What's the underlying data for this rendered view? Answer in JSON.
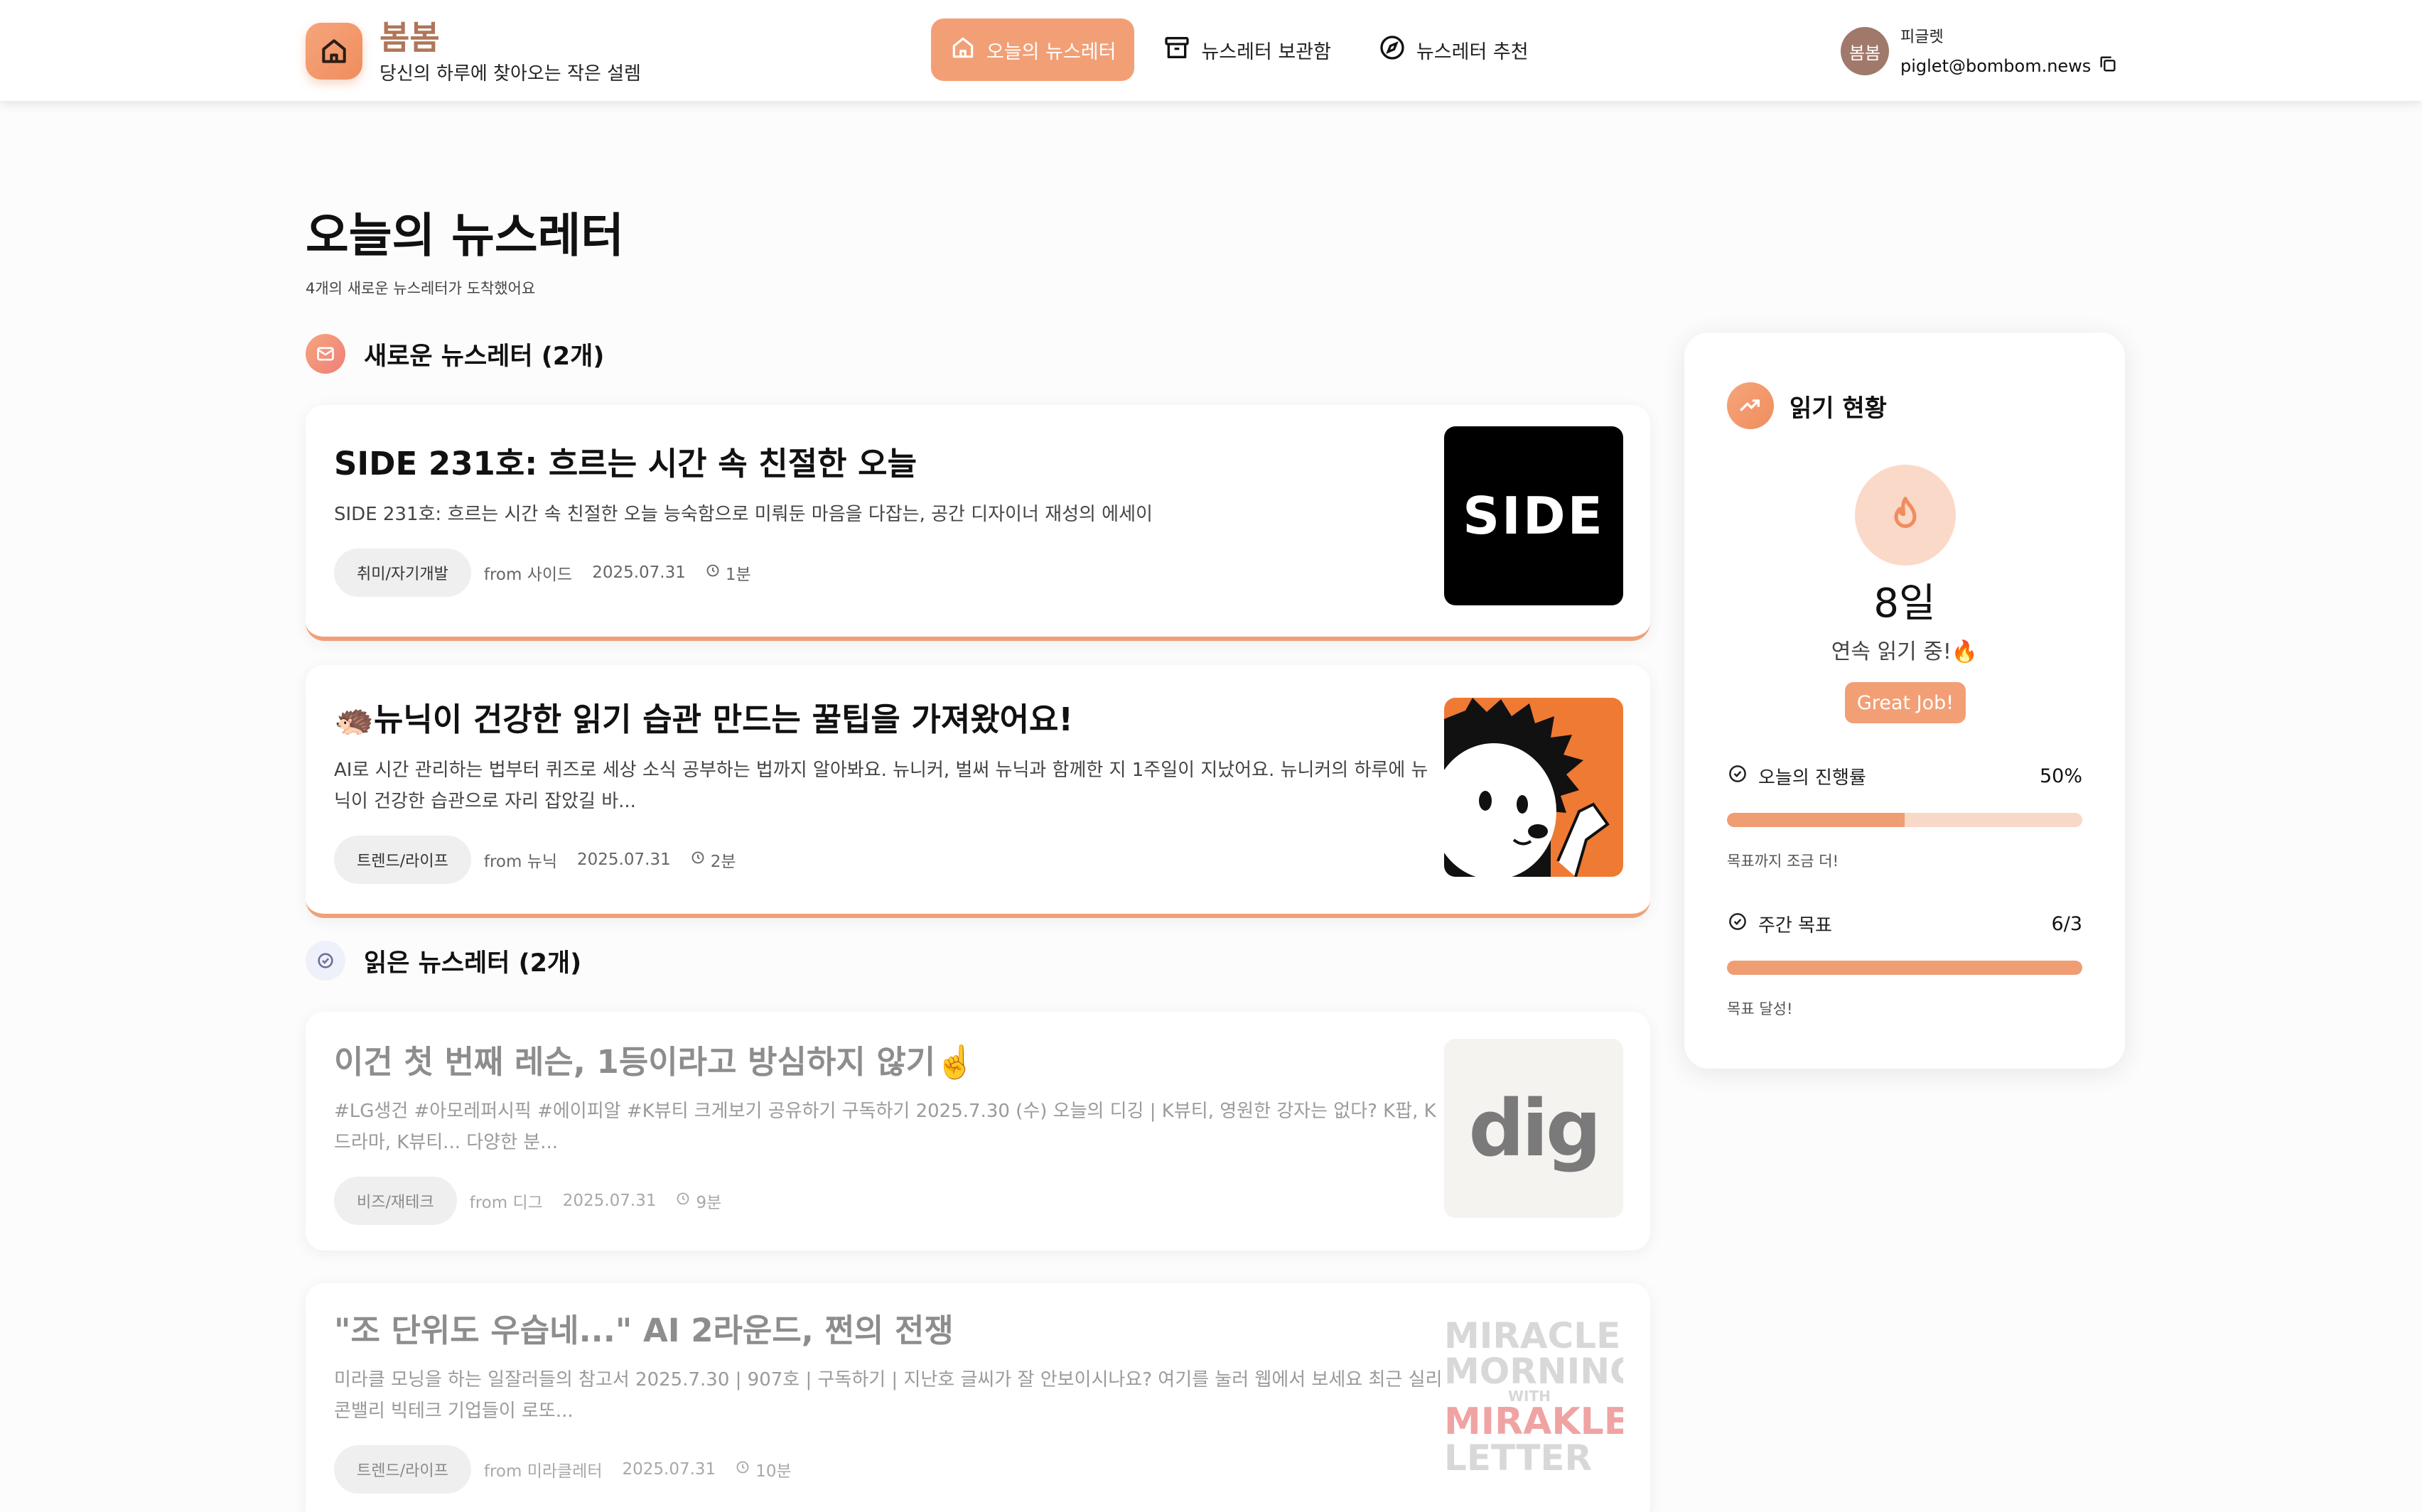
{
  "header": {
    "brand_name": "봄봄",
    "tagline": "당신의 하루에 찾아오는 작은 설렘",
    "nav": [
      {
        "label": "오늘의 뉴스레터",
        "icon": "home-icon",
        "active": true
      },
      {
        "label": "뉴스레터 보관함",
        "icon": "archive-icon",
        "active": false
      },
      {
        "label": "뉴스레터 추천",
        "icon": "compass-icon",
        "active": false
      }
    ],
    "user": {
      "avatar_text": "봄봄",
      "name": "피글렛",
      "email": "piglet@bombom.news"
    }
  },
  "main": {
    "title": "오늘의 뉴스레터",
    "subtitle": "4개의 새로운 뉴스레터가 도착했어요",
    "unread_section": "새로운 뉴스레터 (2개)",
    "read_section": "읽은 뉴스레터 (2개)",
    "unread": [
      {
        "title": "SIDE 231호: 흐르는 시간 속 친절한 오늘",
        "desc": "SIDE 231호: 흐르는 시간 속 친절한 오늘 능숙함으로 미뤄둔 마음을 다잡는, 공간 디자이너 재성의 에세이",
        "category": "취미/자기개발",
        "from": "from 사이드",
        "date": "2025.07.31",
        "time": "1분",
        "thumb_text": "SIDE"
      },
      {
        "title": "🦔뉴닉이 건강한 읽기 습관 만드는 꿀팁을 가져왔어요!",
        "desc": "AI로 시간 관리하는 법부터 퀴즈로 세상 소식 공부하는 법까지 알아봐요. 뉴니커, 벌써 뉴닉과 함께한 지 1주일이 지났어요. 뉴니커의 하루에 뉴닉이 건강한 습관으로 자리 잡았길 바...",
        "category": "트렌드/라이프",
        "from": "from 뉴닉",
        "date": "2025.07.31",
        "time": "2분"
      }
    ],
    "read": [
      {
        "title": "이건 첫 번째 레슨, 1등이라고 방심하지 않기☝️",
        "desc": "#LG생건 #아모레퍼시픽 #에이피알 #K뷰티 크게보기 공유하기 구독하기 2025.7.30 (수) 오늘의 디깅 | K뷰티, 영원한 강자는 없다? K팝, K드라마, K뷰티... 다양한 분...",
        "category": "비즈/재테크",
        "from": "from 디그",
        "date": "2025.07.31",
        "time": "9분",
        "thumb_text": "dig"
      },
      {
        "title": "\"조 단위도 우습네...\" AI 2라운드, 쩐의 전쟁",
        "desc": "미라클 모닝을 하는 일잘러들의 참고서 2025.7.30 | 907호 | 구독하기 | 지난호 글씨가 잘 안보이시나요? 여기를 눌러 웹에서 보세요 최근 실리콘밸리 빅테크 기업들이 로또...",
        "category": "트렌드/라이프",
        "from": "from 미라클레터",
        "date": "2025.07.31",
        "time": "10분",
        "thumb_lines": [
          "MIRACLE",
          "MORNING",
          "WITH",
          "MIRAKLE",
          "LETTER"
        ]
      }
    ]
  },
  "panel": {
    "title": "읽기 현황",
    "streak_days": "8일",
    "streak_label": "연속 읽기 중!🔥",
    "badge": "Great Job!",
    "today_label": "오늘의 진행률",
    "today_value": "50%",
    "today_progress": 0.5,
    "today_note": "목표까지 조금 더!",
    "weekly_label": "주간 목표",
    "weekly_value": "6/3",
    "weekly_progress": 1.0,
    "weekly_note": "목표 달성!"
  },
  "colors": {
    "accent": "#f39f75",
    "accent_light": "#f8d8c7",
    "brand_text": "#b07558"
  }
}
